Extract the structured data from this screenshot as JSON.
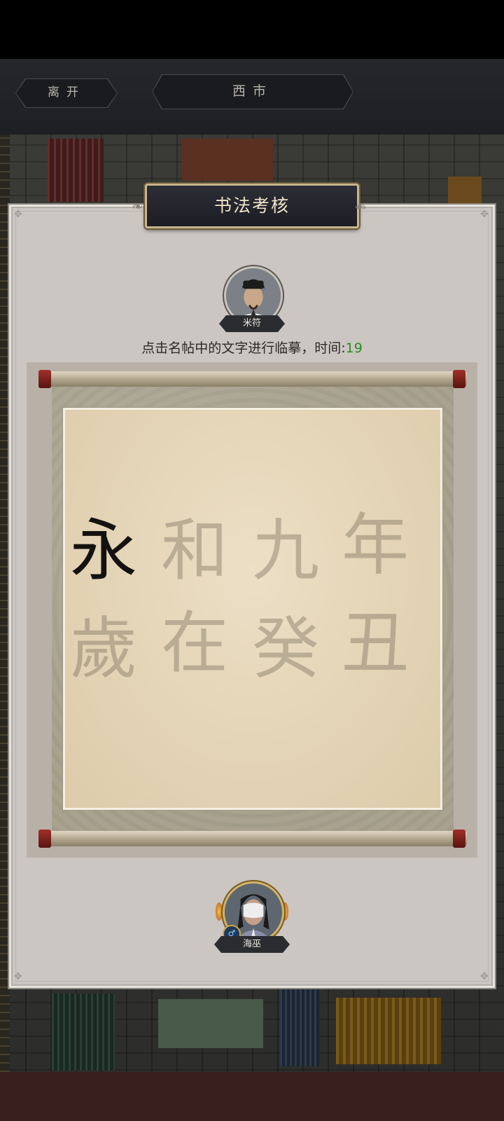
{
  "top_nav": {
    "leave_label": "离开",
    "location_label": "西市"
  },
  "dialog": {
    "title": "书法考核",
    "master": {
      "name": "米符"
    },
    "instruction": "点击名帖中的文字进行临摹，时间:",
    "timer": "19",
    "player": {
      "name": "海巫",
      "gender_icon": "male-icon"
    }
  },
  "calligraphy": {
    "rows": [
      [
        {
          "char": "永",
          "traced": true
        },
        {
          "char": "和",
          "traced": false
        },
        {
          "char": "九",
          "traced": false
        },
        {
          "char": "年",
          "traced": false
        }
      ],
      [
        {
          "char": "歲",
          "traced": false
        },
        {
          "char": "在",
          "traced": false
        },
        {
          "char": "癸",
          "traced": false
        },
        {
          "char": "丑",
          "traced": false
        }
      ]
    ]
  },
  "colors": {
    "timer": "#2f8a22",
    "traced_ink": "#141210",
    "untraced_ink": "rgba(90,80,65,0.32)"
  }
}
